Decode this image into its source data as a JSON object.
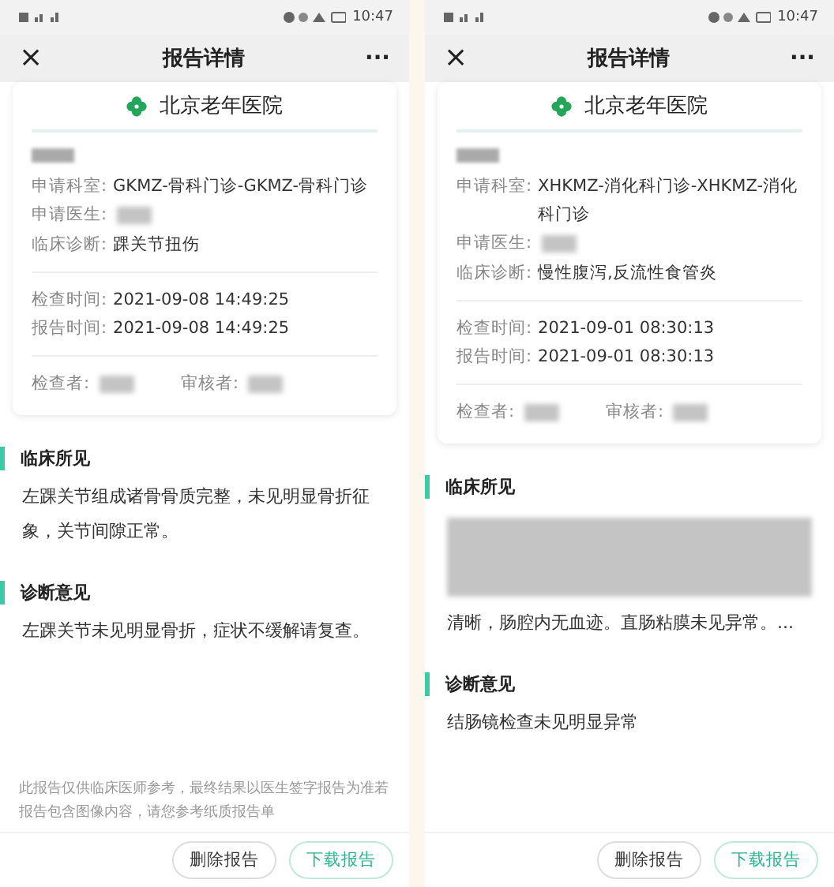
{
  "screens": [
    {
      "status_bar": {
        "time": "10:47"
      },
      "title": "报告详情",
      "close_icon": "×",
      "more_icon": "···",
      "hospital": "北京老年医院",
      "fields": [
        {
          "label": "申请科室:",
          "value": "GKMZ-骨科门诊-GKMZ-骨科门诊"
        },
        {
          "label": "申请医生:",
          "redacted": true
        },
        {
          "label": "临床诊断:",
          "value": "踝关节扭伤"
        }
      ],
      "times": [
        {
          "label": "检查时间:",
          "value": "2021-09-08 14:49:25"
        },
        {
          "label": "报告时间:",
          "value": "2021-09-08 14:49:25"
        }
      ],
      "signers": [
        {
          "label": "检查者:"
        },
        {
          "label": "审核者:"
        }
      ],
      "sections": [
        {
          "title": "临床所见",
          "text": "左踝关节组成诸骨骨质完整，未见明显骨折征象，关节间隙正常。"
        },
        {
          "title": "诊断意见",
          "text": "左踝关节未见明显骨折，症状不缓解请复查。"
        }
      ],
      "disclaimer": "此报告仅供临床医师参考，最终结果以医生签字报告为准若报告包含图像内容，请您参考纸质报告单",
      "buttons": [
        {
          "label": "删除报告",
          "kind": "plain"
        },
        {
          "label": "下载报告",
          "kind": "primary"
        }
      ]
    },
    {
      "status_bar": {
        "time": "10:47"
      },
      "title": "报告详情",
      "close_icon": "×",
      "more_icon": "···",
      "hospital": "北京老年医院",
      "fields": [
        {
          "label": "申请科室:",
          "value": "XHKMZ-消化科门诊-XHKMZ-消化科门诊"
        },
        {
          "label": "申请医生:",
          "redacted": true
        },
        {
          "label": "临床诊断:",
          "value": "慢性腹泻,反流性食管炎"
        }
      ],
      "times": [
        {
          "label": "检查时间:",
          "value": "2021-09-01 08:30:13"
        },
        {
          "label": "报告时间:",
          "value": "2021-09-01 08:30:13"
        }
      ],
      "signers": [
        {
          "label": "检查者:"
        },
        {
          "label": "审核者:"
        }
      ],
      "sections": [
        {
          "title": "临床所见",
          "redacted": true,
          "text": "清晰，肠腔内无血迹。直肠粘膜未见异常。..."
        },
        {
          "title": "诊断意见",
          "text": "结肠镜检查未见明显异常"
        }
      ],
      "buttons": [
        {
          "label": "删除报告",
          "kind": "plain"
        },
        {
          "label": "下载报告",
          "kind": "primary"
        }
      ]
    }
  ]
}
